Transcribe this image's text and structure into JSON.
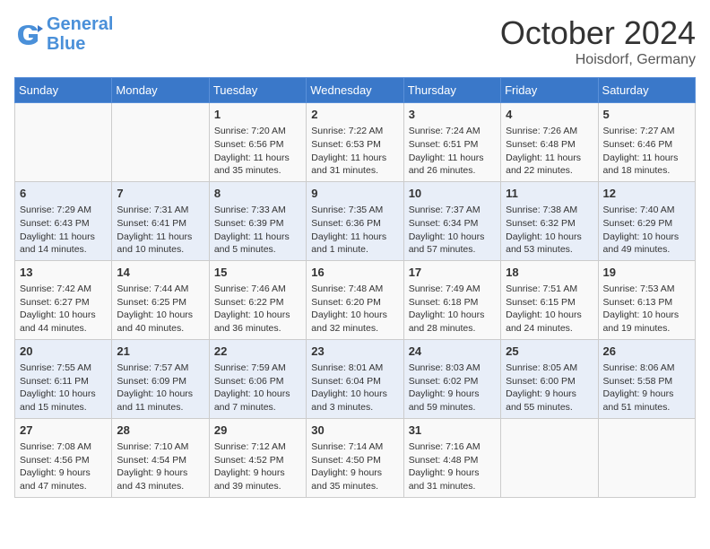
{
  "header": {
    "logo_line1": "General",
    "logo_line2": "Blue",
    "month": "October 2024",
    "location": "Hoisdorf, Germany"
  },
  "weekdays": [
    "Sunday",
    "Monday",
    "Tuesday",
    "Wednesday",
    "Thursday",
    "Friday",
    "Saturday"
  ],
  "weeks": [
    [
      {
        "day": "",
        "info": ""
      },
      {
        "day": "",
        "info": ""
      },
      {
        "day": "1",
        "info": "Sunrise: 7:20 AM\nSunset: 6:56 PM\nDaylight: 11 hours\nand 35 minutes."
      },
      {
        "day": "2",
        "info": "Sunrise: 7:22 AM\nSunset: 6:53 PM\nDaylight: 11 hours\nand 31 minutes."
      },
      {
        "day": "3",
        "info": "Sunrise: 7:24 AM\nSunset: 6:51 PM\nDaylight: 11 hours\nand 26 minutes."
      },
      {
        "day": "4",
        "info": "Sunrise: 7:26 AM\nSunset: 6:48 PM\nDaylight: 11 hours\nand 22 minutes."
      },
      {
        "day": "5",
        "info": "Sunrise: 7:27 AM\nSunset: 6:46 PM\nDaylight: 11 hours\nand 18 minutes."
      }
    ],
    [
      {
        "day": "6",
        "info": "Sunrise: 7:29 AM\nSunset: 6:43 PM\nDaylight: 11 hours\nand 14 minutes."
      },
      {
        "day": "7",
        "info": "Sunrise: 7:31 AM\nSunset: 6:41 PM\nDaylight: 11 hours\nand 10 minutes."
      },
      {
        "day": "8",
        "info": "Sunrise: 7:33 AM\nSunset: 6:39 PM\nDaylight: 11 hours\nand 5 minutes."
      },
      {
        "day": "9",
        "info": "Sunrise: 7:35 AM\nSunset: 6:36 PM\nDaylight: 11 hours\nand 1 minute."
      },
      {
        "day": "10",
        "info": "Sunrise: 7:37 AM\nSunset: 6:34 PM\nDaylight: 10 hours\nand 57 minutes."
      },
      {
        "day": "11",
        "info": "Sunrise: 7:38 AM\nSunset: 6:32 PM\nDaylight: 10 hours\nand 53 minutes."
      },
      {
        "day": "12",
        "info": "Sunrise: 7:40 AM\nSunset: 6:29 PM\nDaylight: 10 hours\nand 49 minutes."
      }
    ],
    [
      {
        "day": "13",
        "info": "Sunrise: 7:42 AM\nSunset: 6:27 PM\nDaylight: 10 hours\nand 44 minutes."
      },
      {
        "day": "14",
        "info": "Sunrise: 7:44 AM\nSunset: 6:25 PM\nDaylight: 10 hours\nand 40 minutes."
      },
      {
        "day": "15",
        "info": "Sunrise: 7:46 AM\nSunset: 6:22 PM\nDaylight: 10 hours\nand 36 minutes."
      },
      {
        "day": "16",
        "info": "Sunrise: 7:48 AM\nSunset: 6:20 PM\nDaylight: 10 hours\nand 32 minutes."
      },
      {
        "day": "17",
        "info": "Sunrise: 7:49 AM\nSunset: 6:18 PM\nDaylight: 10 hours\nand 28 minutes."
      },
      {
        "day": "18",
        "info": "Sunrise: 7:51 AM\nSunset: 6:15 PM\nDaylight: 10 hours\nand 24 minutes."
      },
      {
        "day": "19",
        "info": "Sunrise: 7:53 AM\nSunset: 6:13 PM\nDaylight: 10 hours\nand 19 minutes."
      }
    ],
    [
      {
        "day": "20",
        "info": "Sunrise: 7:55 AM\nSunset: 6:11 PM\nDaylight: 10 hours\nand 15 minutes."
      },
      {
        "day": "21",
        "info": "Sunrise: 7:57 AM\nSunset: 6:09 PM\nDaylight: 10 hours\nand 11 minutes."
      },
      {
        "day": "22",
        "info": "Sunrise: 7:59 AM\nSunset: 6:06 PM\nDaylight: 10 hours\nand 7 minutes."
      },
      {
        "day": "23",
        "info": "Sunrise: 8:01 AM\nSunset: 6:04 PM\nDaylight: 10 hours\nand 3 minutes."
      },
      {
        "day": "24",
        "info": "Sunrise: 8:03 AM\nSunset: 6:02 PM\nDaylight: 9 hours\nand 59 minutes."
      },
      {
        "day": "25",
        "info": "Sunrise: 8:05 AM\nSunset: 6:00 PM\nDaylight: 9 hours\nand 55 minutes."
      },
      {
        "day": "26",
        "info": "Sunrise: 8:06 AM\nSunset: 5:58 PM\nDaylight: 9 hours\nand 51 minutes."
      }
    ],
    [
      {
        "day": "27",
        "info": "Sunrise: 7:08 AM\nSunset: 4:56 PM\nDaylight: 9 hours\nand 47 minutes."
      },
      {
        "day": "28",
        "info": "Sunrise: 7:10 AM\nSunset: 4:54 PM\nDaylight: 9 hours\nand 43 minutes."
      },
      {
        "day": "29",
        "info": "Sunrise: 7:12 AM\nSunset: 4:52 PM\nDaylight: 9 hours\nand 39 minutes."
      },
      {
        "day": "30",
        "info": "Sunrise: 7:14 AM\nSunset: 4:50 PM\nDaylight: 9 hours\nand 35 minutes."
      },
      {
        "day": "31",
        "info": "Sunrise: 7:16 AM\nSunset: 4:48 PM\nDaylight: 9 hours\nand 31 minutes."
      },
      {
        "day": "",
        "info": ""
      },
      {
        "day": "",
        "info": ""
      }
    ]
  ]
}
